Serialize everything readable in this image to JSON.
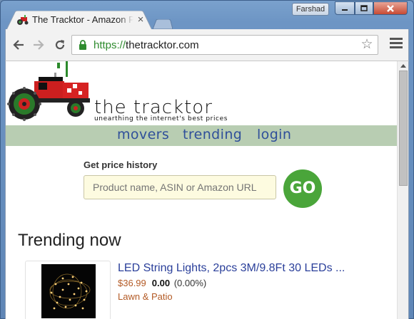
{
  "window": {
    "tab_title": "The Tracktor - Amazon P",
    "tab_close": "×",
    "profile_name": "Farshad"
  },
  "toolbar": {
    "url_scheme": "https://",
    "url_host": "thetracktor.com",
    "star": "☆"
  },
  "site": {
    "brand_name": "the tracktor",
    "tagline": "unearthing the internet's best prices",
    "nav": {
      "movers": "movers",
      "trending": "trending",
      "login": "login"
    },
    "search": {
      "label": "Get price history",
      "placeholder": "Product name, ASIN or Amazon URL",
      "go_label": "GO"
    },
    "trending_title": "Trending now",
    "products": [
      {
        "title": "LED String Lights, 2pcs 3M/9.8Ft 30 LEDs ...",
        "price": "$36.99",
        "change": "0.00",
        "change_pct": "(0.00%)",
        "category": "Lawn & Patio"
      }
    ]
  },
  "colors": {
    "navbar_bg": "#b8cdb2",
    "link": "#2f4f9a",
    "go_button": "#4aa53a",
    "price": "#b35a25",
    "secure_green": "#2e8b2e"
  }
}
